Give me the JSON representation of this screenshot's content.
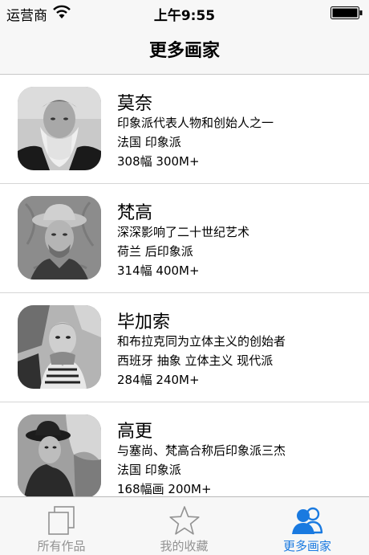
{
  "status_bar": {
    "carrier": "运营商",
    "time": "上午9:55"
  },
  "nav": {
    "title": "更多画家"
  },
  "painters": [
    {
      "name": "莫奈",
      "description": "印象派代表人物和创始人之一",
      "tags": "法国  印象派",
      "stats": "308幅 300M+"
    },
    {
      "name": "梵高",
      "description": "深深影响了二十世纪艺术",
      "tags": "荷兰 后印象派",
      "stats": "314幅 400M+"
    },
    {
      "name": "毕加索",
      "description": "和布拉克同为立体主义的创始者",
      "tags": "西班牙 抽象 立体主义 现代派",
      "stats": "284幅 240M+"
    },
    {
      "name": "高更",
      "description": "与塞尚、梵高合称后印象派三杰",
      "tags": "法国 印象派",
      "stats": "168幅画 200M+"
    }
  ],
  "tabs": [
    {
      "label": "所有作品",
      "icon": "copies-icon",
      "active": false
    },
    {
      "label": "我的收藏",
      "icon": "star-icon",
      "active": false
    },
    {
      "label": "更多画家",
      "icon": "people-icon",
      "active": true
    }
  ],
  "colors": {
    "accent": "#1a7ae0",
    "inactive": "#929292",
    "bar_background": "#f7f7f7"
  }
}
